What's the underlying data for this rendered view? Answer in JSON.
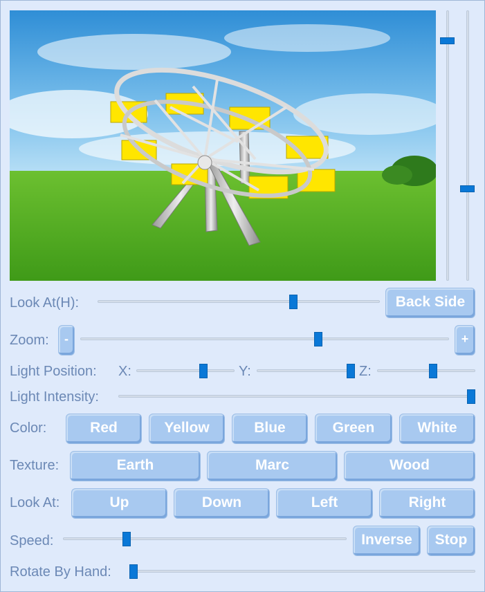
{
  "viewport": {
    "scene": "ferris-wheel-3d",
    "sky_color": "#5aa8e0",
    "grass_color": "#4fa51f",
    "cabin_color": "#ffe600",
    "frame_color": "#c8c8c8"
  },
  "vertical_sliders": {
    "left": {
      "value": 0.11
    },
    "right": {
      "value": 0.66
    }
  },
  "look_at_h": {
    "label": "Look At(H):",
    "value": 0.69,
    "back_side_label": "Back Side"
  },
  "zoom": {
    "label": "Zoom:",
    "minus_label": "-",
    "plus_label": "+",
    "value": 0.64
  },
  "light_position": {
    "label": "Light Position:",
    "x_label": "X:",
    "y_label": "Y:",
    "z_label": "Z:",
    "x_value": 0.68,
    "y_value": 0.98,
    "z_value": 0.56
  },
  "light_intensity": {
    "label": "Light Intensity:",
    "value": 1.0
  },
  "color": {
    "label": "Color:",
    "options": [
      "Red",
      "Yellow",
      "Blue",
      "Green",
      "White"
    ]
  },
  "texture": {
    "label": "Texture:",
    "options": [
      "Earth",
      "Marc",
      "Wood"
    ]
  },
  "look_at": {
    "label": "Look At:",
    "options": [
      "Up",
      "Down",
      "Left",
      "Right"
    ]
  },
  "speed": {
    "label": "Speed:",
    "value": 0.22,
    "inverse_label": "Inverse",
    "stop_label": "Stop"
  },
  "rotate_by_hand": {
    "label": "Rotate By Hand:",
    "value": 0.0
  },
  "colors": {
    "accent": "#0a78d7",
    "label_text": "#6b88b5",
    "button_bg": "#a8c9f0",
    "panel_bg": "#dfeafb"
  }
}
